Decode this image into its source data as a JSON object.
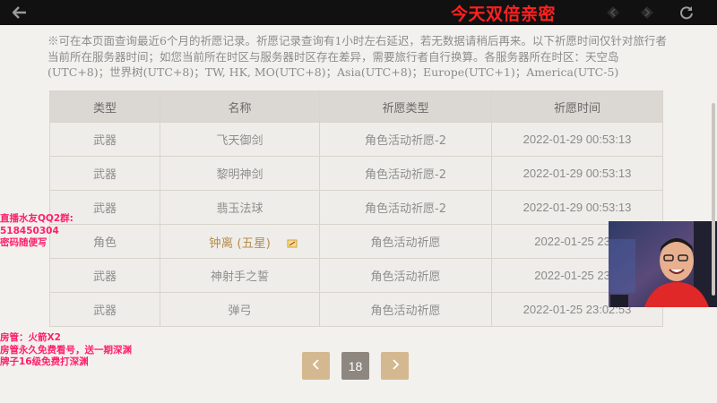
{
  "toolbar": {
    "back_icon": "back-arrow-icon",
    "prev_icon": "diamond-left-icon",
    "next_icon": "diamond-right-icon",
    "refresh_icon": "refresh-icon"
  },
  "overlay_title": "今天双倍亲密",
  "notice": "※可在本页面查询最近6个月的祈愿记录。祈愿记录查询有1小时左右延迟，若无数据请稍后再来。以下祈愿时间仅针对旅行者当前所在服务器时间；如您当前所在时区与服务器时区存在差异，需要旅行者自行换算。各服务器所在时区：天空岛(UTC+8)；世界树(UTC+8)；TW, HK, MO(UTC+8)；Asia(UTC+8)；Europe(UTC+1)；America(UTC-5)",
  "table": {
    "headers": [
      "类型",
      "名称",
      "祈愿类型",
      "祈愿时间"
    ],
    "rows": [
      {
        "type": "武器",
        "name": "飞天御剑",
        "wish": "角色活动祈愿-2",
        "time": "2022-01-29 00:53:13"
      },
      {
        "type": "武器",
        "name": "黎明神剑",
        "wish": "角色活动祈愿-2",
        "time": "2022-01-29 00:53:13"
      },
      {
        "type": "武器",
        "name": "翡玉法球",
        "wish": "角色活动祈愿-2",
        "time": "2022-01-29 00:53:13"
      },
      {
        "type": "角色",
        "name": "钟离 (五星)",
        "wish": "角色活动祈愿",
        "time": "2022-01-25 23:0"
      },
      {
        "type": "武器",
        "name": "神射手之誓",
        "wish": "角色活动祈愿",
        "time": "2022-01-25 23:0"
      },
      {
        "type": "武器",
        "name": "弹弓",
        "wish": "角色活动祈愿",
        "time": "2022-01-25 23:02:53"
      }
    ]
  },
  "pagination": {
    "prev_icon": "chevron-left-icon",
    "current_page": "18",
    "next_icon": "chevron-right-icon",
    "button_color": "#d4b88f",
    "current_color": "#8e8780"
  },
  "overlay_left": {
    "qq_line1": "直播水友QQ2群:",
    "qq_line2": "518450304",
    "qq_line3": "密码随便写",
    "admin_line1": "房管：火箭X2",
    "admin_line2": "房管永久免费看号，送一期深渊",
    "admin_line3": "牌子16级免费打深渊"
  },
  "colors": {
    "overlay_red": "#ff2121",
    "overlay_pink": "#ff1f6c",
    "five_star": "#b58e52"
  }
}
